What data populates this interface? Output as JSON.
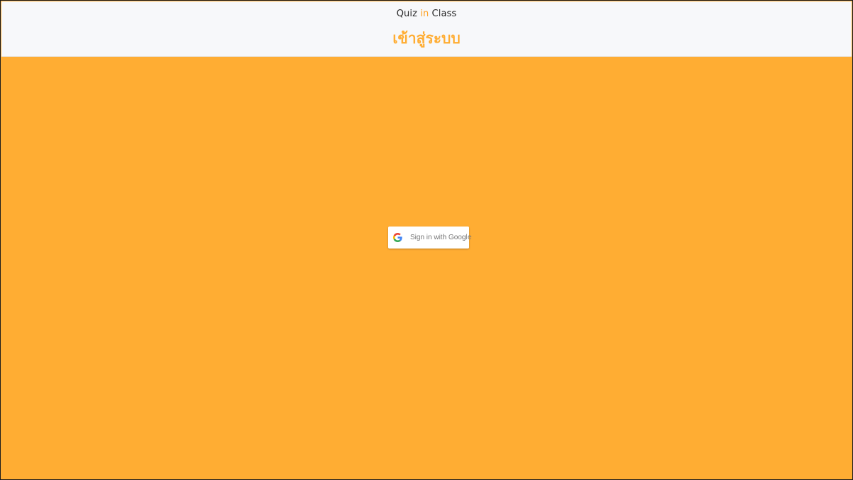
{
  "header": {
    "brand": {
      "part1": "Quiz ",
      "accent": "in",
      "part2": " Class"
    },
    "title": "เข้าสู่ระบบ"
  },
  "login": {
    "google_button_label": "Sign in with Google",
    "google_icon": "google-g-icon"
  },
  "colors": {
    "background_orange": "#ffad33",
    "header_background": "#f7f8fa",
    "brand_accent": "#ff9f1c",
    "title_color": "#ffad33"
  }
}
